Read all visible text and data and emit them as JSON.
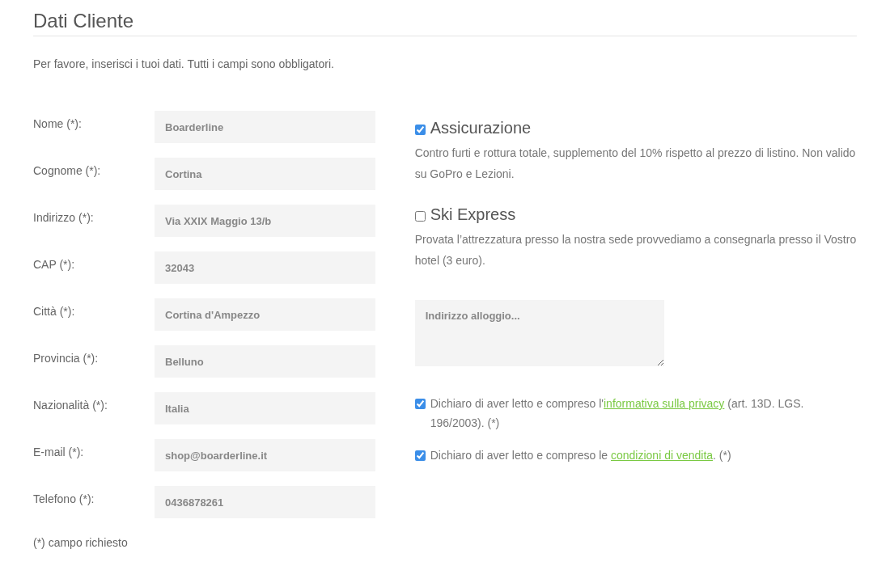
{
  "title": "Dati Cliente",
  "intro": "Per favore, inserisci i tuoi dati. Tutti i campi sono obbligatori.",
  "fields": [
    {
      "label": "Nome (*):",
      "value": "Boarderline"
    },
    {
      "label": "Cognome (*):",
      "value": "Cortina"
    },
    {
      "label": "Indirizzo (*):",
      "value": "Via XXIX Maggio 13/b"
    },
    {
      "label": "CAP (*):",
      "value": "32043"
    },
    {
      "label": "Città (*):",
      "value": "Cortina d'Ampezzo"
    },
    {
      "label": "Provincia (*):",
      "value": "Belluno"
    },
    {
      "label": "Nazionalità (*):",
      "value": "Italia"
    },
    {
      "label": "E-mail (*):",
      "value": "shop@boarderline.it"
    },
    {
      "label": "Telefono (*):",
      "value": "0436878261"
    }
  ],
  "footnote": "(*) campo richiesto",
  "options": [
    {
      "title": "Assicurazione",
      "checked": true,
      "description": "Contro furti e rottura totale, supplemento del 10% rispetto al prezzo di listino. Non valido su GoPro e Lezioni."
    },
    {
      "title": "Ski Express",
      "checked": false,
      "description": "Provata l’attrezzatura presso la nostra sede provvediamo a consegnarla presso il Vostro hotel (3 euro)."
    }
  ],
  "accommodation": {
    "placeholder": "Indirizzo alloggio..."
  },
  "consents": [
    {
      "checked": true,
      "before": "Dichiaro di aver letto e compreso l'",
      "link": "informativa sulla privacy",
      "after": " (art. 13D. LGS. 196/2003). (*)"
    },
    {
      "checked": true,
      "before": "Dichiaro di aver letto e compreso le ",
      "link": "condizioni di vendita",
      "after": ". (*)"
    }
  ]
}
